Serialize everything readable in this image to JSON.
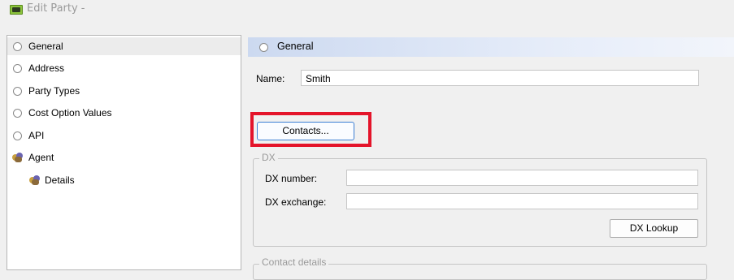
{
  "window": {
    "title": "Edit Party -"
  },
  "nav": {
    "items": [
      {
        "label": "General",
        "icon": "radio-circle-icon",
        "selected": true
      },
      {
        "label": "Address",
        "icon": "radio-circle-icon"
      },
      {
        "label": "Party Types",
        "icon": "radio-circle-icon"
      },
      {
        "label": "Cost Option Values",
        "icon": "radio-circle-icon"
      },
      {
        "label": "API",
        "icon": "radio-circle-icon"
      },
      {
        "label": "Agent",
        "icon": "agent-people-icon"
      },
      {
        "label": "Details",
        "icon": "agent-people-icon"
      }
    ]
  },
  "section": {
    "header": "General",
    "name_label": "Name:",
    "name_value": "Smith",
    "contacts_button": "Contacts...",
    "dx": {
      "legend": "DX",
      "number_label": "DX number:",
      "number_value": "",
      "exchange_label": "DX exchange:",
      "exchange_value": "",
      "lookup_button": "DX Lookup"
    },
    "contact_details_legend": "Contact details"
  },
  "colors": {
    "highlight": "#e4142a",
    "header_gradient_start": "#ccd9f0",
    "focus_border": "#3c7fd4"
  }
}
